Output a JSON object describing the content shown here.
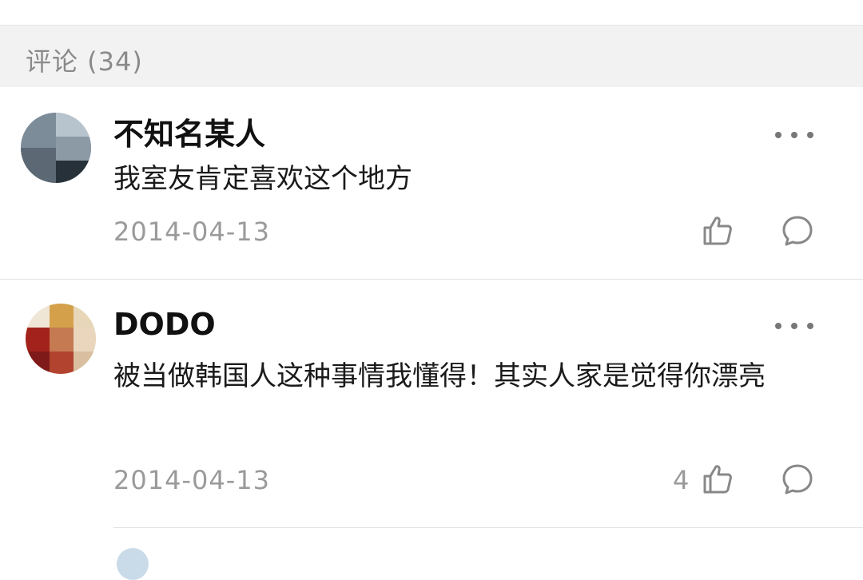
{
  "section": {
    "title": "评论 (34)"
  },
  "comments": [
    {
      "username": "不知名某人",
      "text": "我室友肯定喜欢这个地方",
      "date": "2014-04-13",
      "likes": ""
    },
    {
      "username": "DODO",
      "text": "被当做韩国人这种事情我懂得！其实人家是觉得你漂亮",
      "date": "2014-04-13",
      "likes": "4"
    }
  ],
  "icons": {
    "more": "more-dots-icon",
    "like": "thumbs-up-icon",
    "reply": "comment-bubble-icon"
  },
  "colors": {
    "header_bg": "#f2f2f2",
    "muted_text": "#9a9a9a",
    "icon_stroke": "#888888"
  }
}
